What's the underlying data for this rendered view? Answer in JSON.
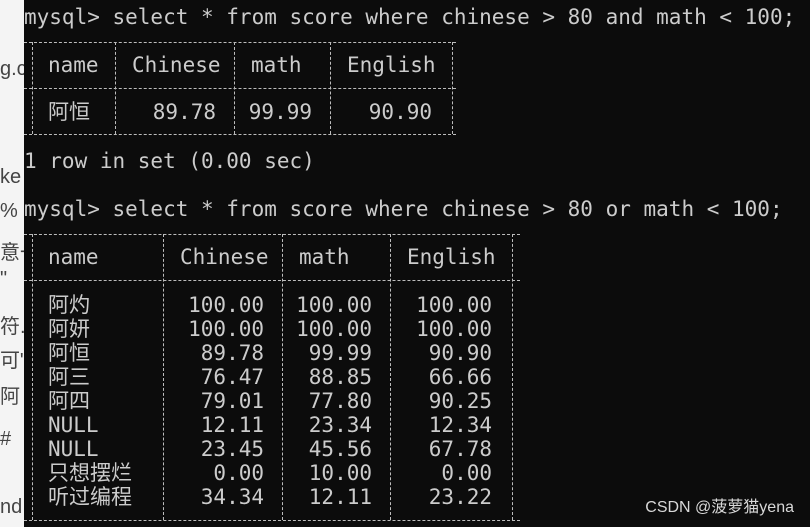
{
  "background_fragments": [
    "g.c",
    "ke",
    "%",
    "意一",
    "\"",
    "符.",
    "可\"",
    "阿",
    "#",
    "nd"
  ],
  "terminal": {
    "query1": "mysql> select * from score where chinese > 80 and math < 100;",
    "query2": "mysql> select * from score where chinese > 80 or math < 100;",
    "result1_summary": "1 row in set (0.00 sec)"
  },
  "table1": {
    "headers": [
      "name",
      "Chinese",
      "math",
      "English"
    ],
    "rows": [
      [
        "阿恒",
        "89.78",
        "99.99",
        "90.90"
      ]
    ]
  },
  "table2": {
    "headers": [
      "name",
      "Chinese",
      "math",
      "English"
    ],
    "rows": [
      [
        "阿灼",
        "100.00",
        "100.00",
        "100.00"
      ],
      [
        "阿妍",
        "100.00",
        "100.00",
        "100.00"
      ],
      [
        "阿恒",
        "89.78",
        "99.99",
        "90.90"
      ],
      [
        "阿三",
        "76.47",
        "88.85",
        "66.66"
      ],
      [
        "阿四",
        "79.01",
        "77.80",
        "90.25"
      ],
      [
        "NULL",
        "12.11",
        "23.34",
        "12.34"
      ],
      [
        "NULL",
        "23.45",
        "45.56",
        "67.78"
      ],
      [
        "只想摆烂",
        "0.00",
        "10.00",
        "0.00"
      ],
      [
        "听过编程",
        "34.34",
        "12.11",
        "23.22"
      ]
    ]
  },
  "watermark": "CSDN @菠萝猫yena"
}
